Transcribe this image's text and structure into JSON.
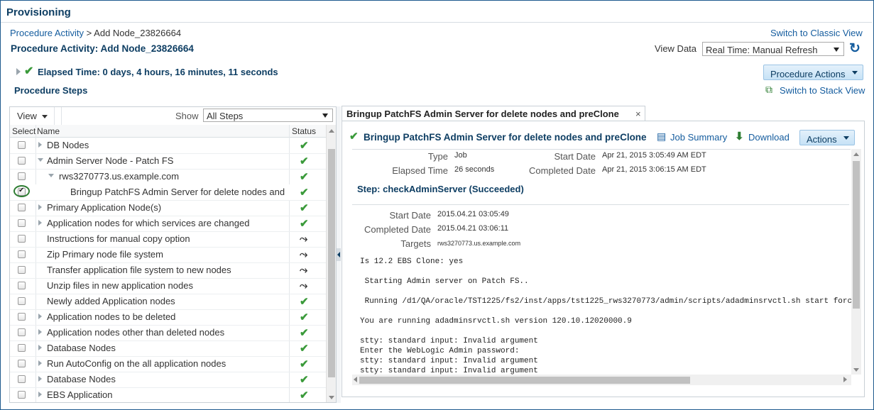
{
  "header": {
    "title": "Provisioning"
  },
  "breadcrumb": {
    "parent": "Procedure Activity",
    "separator": ">",
    "current": "Add Node_23826664"
  },
  "switch_classic": "Switch to Classic View",
  "page_title": "Procedure Activity: Add Node_23826664",
  "view_data": {
    "label": "View Data",
    "value": "Real Time: Manual Refresh"
  },
  "elapsed": "Elapsed Time: 0 days, 4 hours, 16 minutes, 11 seconds",
  "procedure_actions": "Procedure Actions",
  "procedure_steps": "Procedure Steps",
  "switch_stack": "Switch to Stack View",
  "left_toolbar": {
    "view": "View",
    "show_label": "Show",
    "show_value": "All Steps"
  },
  "columns": {
    "select": "Select",
    "name": "Name",
    "status": "Status"
  },
  "steps": [
    {
      "name": "DB Nodes",
      "status": "done"
    },
    {
      "name": "Admin Server Node - Patch FS",
      "status": "done"
    },
    {
      "name": "rws3270773.us.example.com",
      "status": "done"
    },
    {
      "name": "Bringup PatchFS Admin Server for delete nodes and",
      "status": "done"
    },
    {
      "name": "Primary Application Node(s)",
      "status": "done"
    },
    {
      "name": "Application nodes for which services are changed",
      "status": "done"
    },
    {
      "name": "Instructions for manual copy option",
      "status": "skipped"
    },
    {
      "name": "Zip Primary node file system",
      "status": "skipped"
    },
    {
      "name": "Transfer application file system to new nodes",
      "status": "skipped"
    },
    {
      "name": "Unzip files in new application nodes",
      "status": "skipped"
    },
    {
      "name": "Newly added Application nodes",
      "status": "done"
    },
    {
      "name": "Application nodes to be deleted",
      "status": "done"
    },
    {
      "name": "Application nodes other than deleted nodes",
      "status": "done"
    },
    {
      "name": "Database Nodes",
      "status": "done"
    },
    {
      "name": "Run AutoConfig on the all application nodes",
      "status": "done"
    },
    {
      "name": "Database Nodes",
      "status": "done"
    },
    {
      "name": "EBS Application",
      "status": "done"
    }
  ],
  "detail_tab": {
    "label": "Bringup PatchFS Admin Server for delete nodes and preClone",
    "close": "×"
  },
  "detail": {
    "title": "Bringup PatchFS Admin Server for delete nodes and preClone",
    "job_summary": "Job Summary",
    "download": "Download",
    "actions": "Actions",
    "type_label": "Type",
    "type_value": "Job",
    "start_label": "Start Date",
    "start_value": "Apr 21, 2015 3:05:49 AM EDT",
    "elapsed_label": "Elapsed Time",
    "elapsed_value": "26 seconds",
    "completed_label": "Completed Date",
    "completed_value": "Apr 21, 2015 3:06:15 AM EDT",
    "step_title": "Step: checkAdminServer (Succeeded)",
    "step_start_label": "Start Date",
    "step_start_value": "2015.04.21 03:05:49",
    "step_completed_label": "Completed Date",
    "step_completed_value": "2015.04.21 03:06:11",
    "targets_label": "Targets",
    "targets_value": "rws3270773.us.example.com",
    "console": "Is 12.2 EBS Clone: yes\n\n Starting Admin server on Patch FS..\n\n Running /d1/QA/oracle/TST1225/fs2/inst/apps/tst1225_rws3270773/admin/scripts/adadminsrvctl.sh start forc\n\nYou are running adadminsrvctl.sh version 120.10.12020000.9\n\nstty: standard input: Invalid argument\nEnter the WebLogic Admin password:\nstty: standard input: Invalid argument\nstty: standard input: Invalid argument"
  }
}
